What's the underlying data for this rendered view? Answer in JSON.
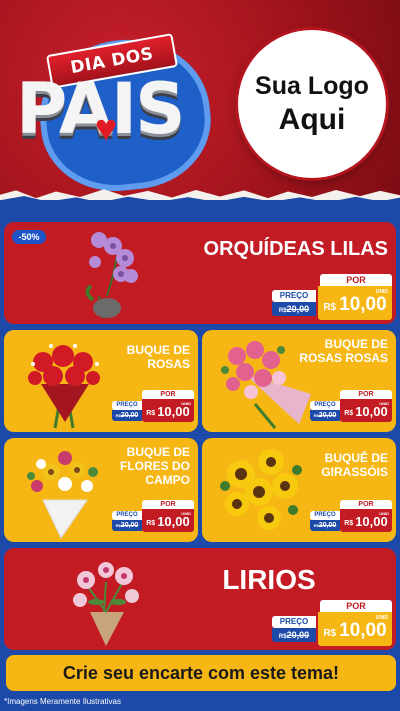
{
  "header": {
    "ribbon_text": "DIA DOS",
    "title_text": "PAIS",
    "logo_line1": "Sua Logo",
    "logo_line2": "Aqui"
  },
  "products": [
    {
      "name": "ORQUÍDEAS LILAS",
      "discount": "-50%",
      "por": "POR",
      "preco": "PREÇO",
      "old_prefix": "R$",
      "old_price": "20,00",
      "currency": "R$",
      "new_price": "10,00",
      "unit": "UNID",
      "image": "orchid-icon"
    },
    {
      "name": "BUQUE DE ROSAS",
      "por": "POR",
      "preco": "PREÇO",
      "old_prefix": "R$",
      "old_price": "20,00",
      "currency": "R$",
      "new_price": "10,00",
      "unit": "UNID",
      "image": "rose-bouquet-icon"
    },
    {
      "name": "BUQUE DE ROSAS ROSAS",
      "por": "POR",
      "preco": "PREÇO",
      "old_prefix": "R$",
      "old_price": "20,00",
      "currency": "R$",
      "new_price": "10,00",
      "unit": "UNID",
      "image": "pink-rose-bouquet-icon"
    },
    {
      "name": "BUQUE DE FLORES DO CAMPO",
      "por": "POR",
      "preco": "PREÇO",
      "old_prefix": "R$",
      "old_price": "20,00",
      "currency": "R$",
      "new_price": "10,00",
      "unit": "UNID",
      "image": "wildflower-bouquet-icon"
    },
    {
      "name": "BUQUÊ DE GIRASSÓIS",
      "por": "POR",
      "preco": "PREÇO",
      "old_prefix": "R$",
      "old_price": "20,00",
      "currency": "R$",
      "new_price": "10,00",
      "unit": "UNID",
      "image": "sunflower-icon"
    },
    {
      "name": "LIRIOS",
      "por": "POR",
      "preco": "PREÇO",
      "old_prefix": "R$",
      "old_price": "20,00",
      "currency": "R$",
      "new_price": "10,00",
      "unit": "UNID",
      "image": "lily-icon"
    }
  ],
  "cta_text": "Crie seu encarte com este tema!",
  "disclaimer": "*Imagens Meramente Ilustrativas",
  "colors": {
    "brand_red": "#c21b24",
    "brand_yellow": "#f6b715",
    "brand_blue": "#1d4aa8"
  }
}
